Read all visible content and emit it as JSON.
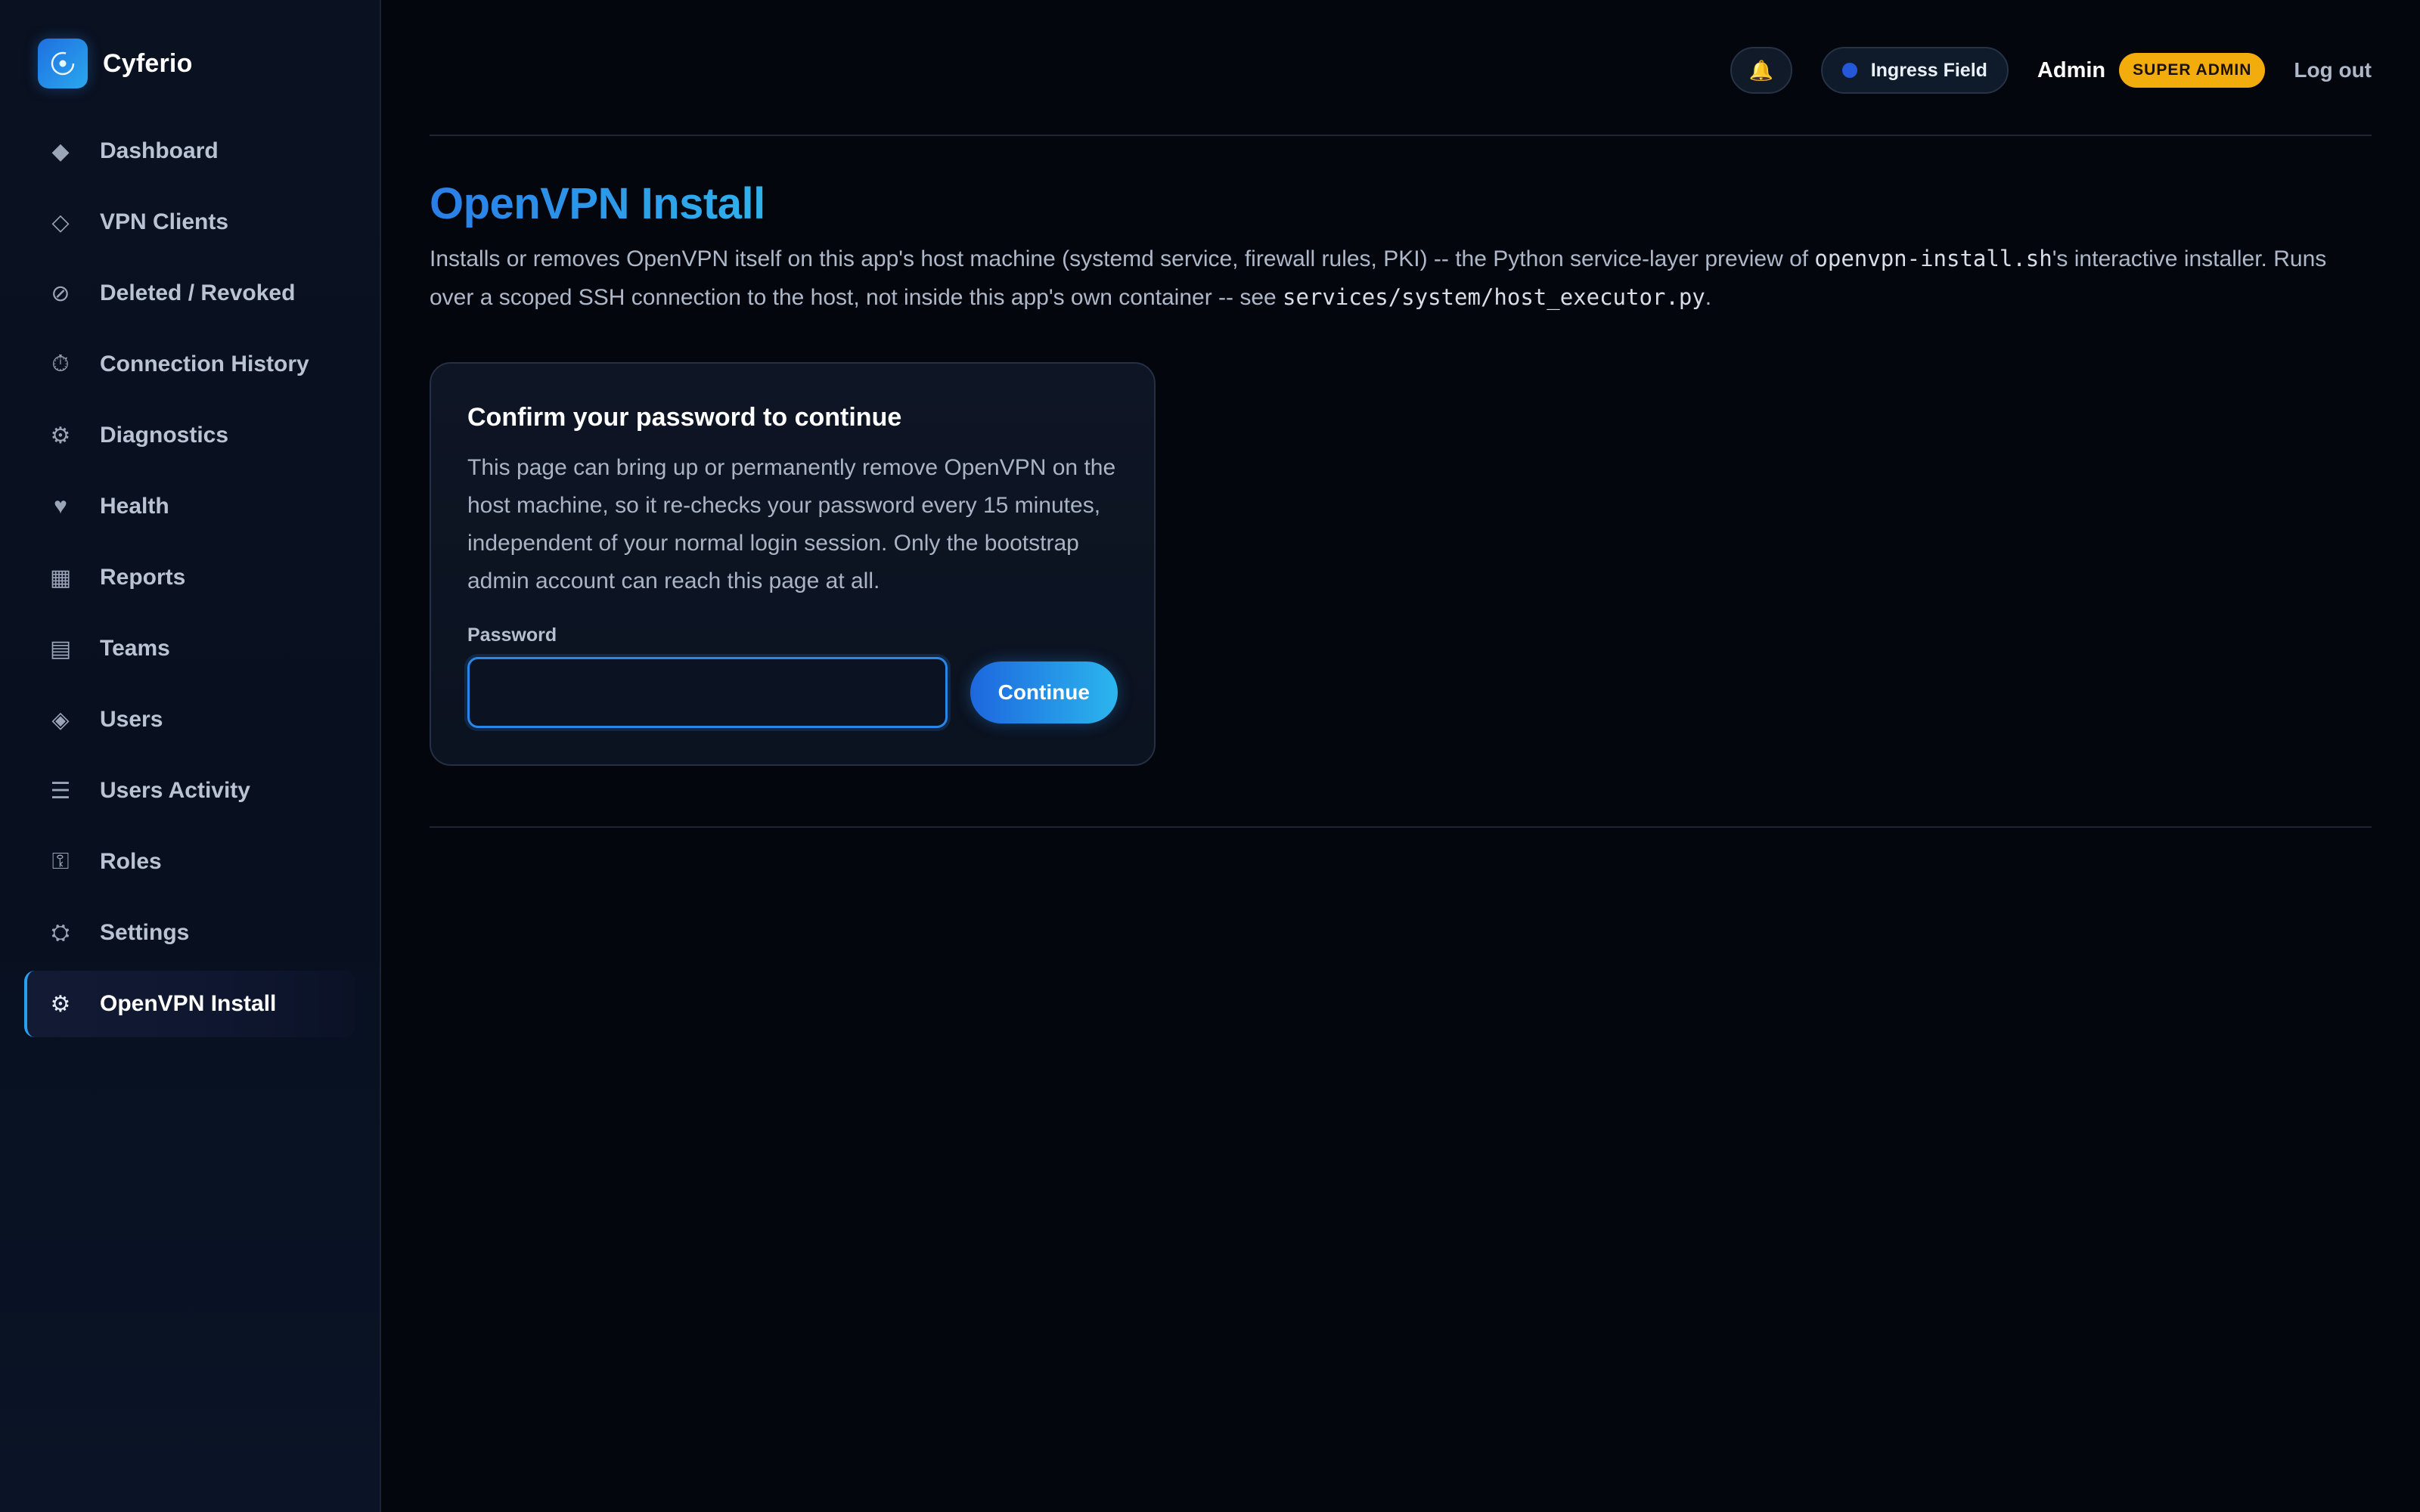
{
  "brand": {
    "name": "Cyferio"
  },
  "sidebar": {
    "items": [
      {
        "label": "Dashboard",
        "icon": "◆"
      },
      {
        "label": "VPN Clients",
        "icon": "◇"
      },
      {
        "label": "Deleted / Revoked",
        "icon": "⊘"
      },
      {
        "label": "Connection History",
        "icon": "⏱"
      },
      {
        "label": "Diagnostics",
        "icon": "⚙"
      },
      {
        "label": "Health",
        "icon": "♥"
      },
      {
        "label": "Reports",
        "icon": "▦"
      },
      {
        "label": "Teams",
        "icon": "▤"
      },
      {
        "label": "Users",
        "icon": "◈"
      },
      {
        "label": "Users Activity",
        "icon": "☰"
      },
      {
        "label": "Roles",
        "icon": "⚿"
      },
      {
        "label": "Settings",
        "icon": "⛭"
      },
      {
        "label": "OpenVPN Install",
        "icon": "⚙"
      }
    ],
    "active_index": 12
  },
  "header": {
    "bell_icon": "🔔",
    "environment": "Ingress Field",
    "user": "Admin",
    "role": "SUPER ADMIN",
    "logout": "Log out"
  },
  "page": {
    "title": "OpenVPN Install",
    "desc_part1": "Installs or removes OpenVPN itself on this app's host machine (systemd service, firewall rules, PKI) -- the Python service-layer preview of ",
    "desc_code1": "openvpn-install.sh",
    "desc_part2": "'s interactive installer. Runs over a scoped SSH connection to the host, not inside this app's own container -- see ",
    "desc_code2": "services/system/host_executor.py",
    "desc_part3": "."
  },
  "card": {
    "title": "Confirm your password to continue",
    "text": "This page can bring up or permanently remove OpenVPN on the host machine, so it re-checks your password every 15 minutes, independent of your normal login session. Only the bootstrap admin account can reach this page at all.",
    "password_label": "Password",
    "password_value": "",
    "continue_label": "Continue"
  }
}
